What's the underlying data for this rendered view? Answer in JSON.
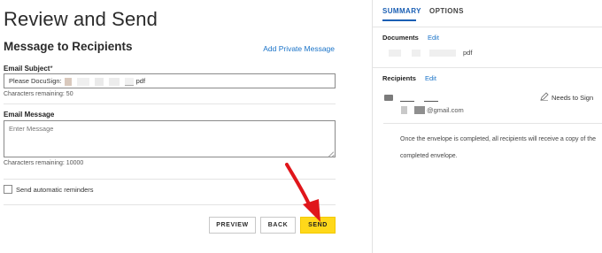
{
  "main": {
    "title": "Review and Send",
    "section_title": "Message to Recipients",
    "add_private_message": "Add Private Message",
    "email_subject": {
      "label": "Email Subject",
      "required_mark": "*",
      "value_prefix": "Please DocuSign:",
      "value_suffix": "pdf",
      "chars_remaining": "Characters remaining: 50"
    },
    "email_message": {
      "label": "Email Message",
      "placeholder": "Enter Message",
      "chars_remaining": "Characters remaining: 10000"
    },
    "reminders_label": "Send automatic reminders",
    "reminders_checked": false,
    "buttons": {
      "preview": "PREVIEW",
      "back": "BACK",
      "send": "SEND"
    },
    "colors": {
      "send_button": "#ffd81a",
      "arrow": "#e0161b",
      "link": "#1a73c8"
    }
  },
  "summary_panel": {
    "tabs": [
      "SUMMARY",
      "OPTIONS"
    ],
    "active_tab": "SUMMARY",
    "documents": {
      "label": "Documents",
      "edit": "Edit",
      "file_suffix": "pdf"
    },
    "recipients": {
      "label": "Recipients",
      "edit": "Edit",
      "email_suffix": "@gmail.com",
      "action": "Needs to Sign"
    },
    "note": "Once the envelope is completed, all recipients will receive a copy of the completed envelope."
  }
}
